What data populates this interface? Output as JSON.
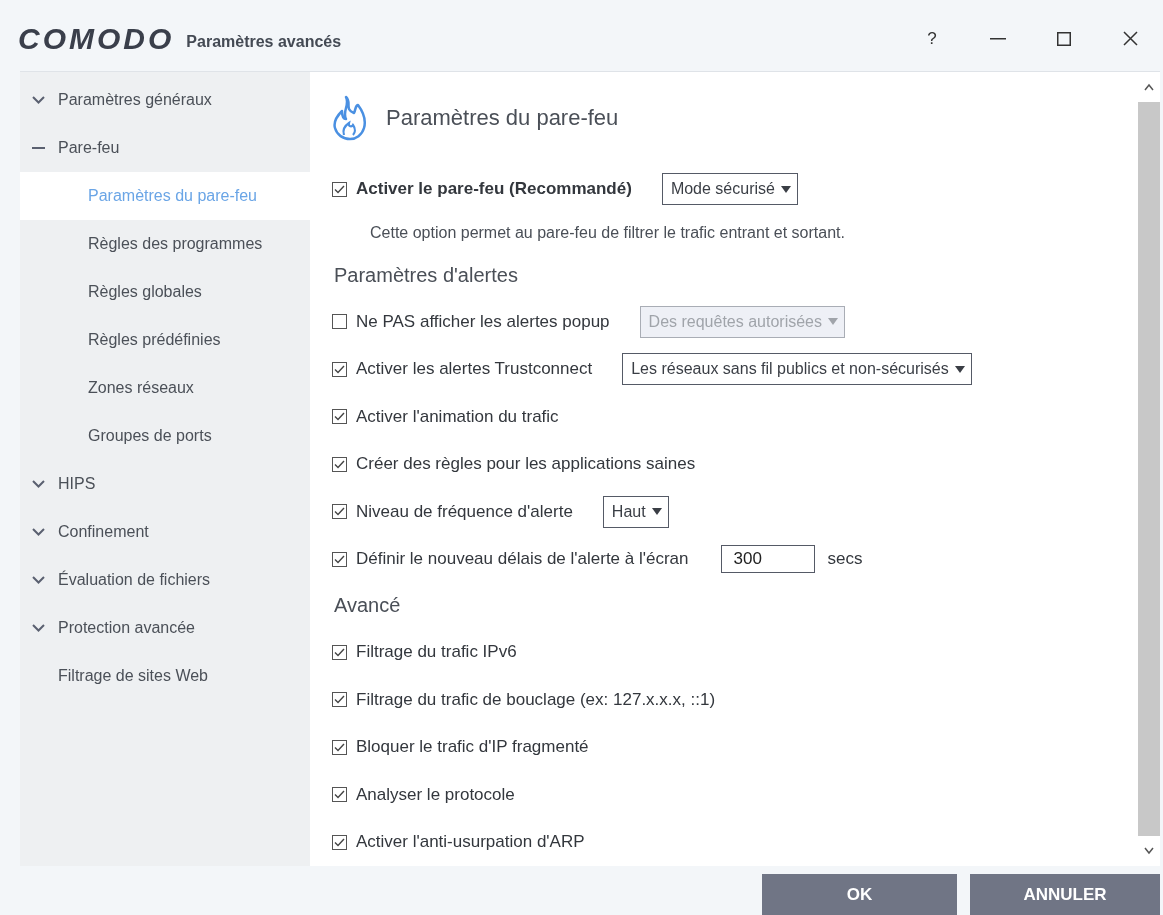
{
  "window": {
    "logo": "COMODO",
    "title": "Paramètres avancés",
    "controls": [
      {
        "kind": "help",
        "label": "?"
      },
      {
        "kind": "minimize"
      },
      {
        "kind": "maximize"
      },
      {
        "kind": "close"
      }
    ]
  },
  "sidebar": {
    "items": [
      {
        "kind": "group",
        "label": "Paramètres généraux",
        "expanded": false
      },
      {
        "kind": "group",
        "label": "Pare-feu",
        "expanded": true,
        "children": [
          {
            "label": "Paramètres du pare-feu",
            "selected": true
          },
          {
            "label": "Règles des programmes",
            "selected": false
          },
          {
            "label": "Règles globales",
            "selected": false
          },
          {
            "label": "Règles prédéfinies",
            "selected": false
          },
          {
            "label": "Zones réseaux",
            "selected": false
          },
          {
            "label": "Groupes de ports",
            "selected": false
          }
        ]
      },
      {
        "kind": "group",
        "label": "HIPS",
        "expanded": false
      },
      {
        "kind": "group",
        "label": "Confinement",
        "expanded": false
      },
      {
        "kind": "group",
        "label": "Évaluation de fichiers",
        "expanded": false
      },
      {
        "kind": "group",
        "label": "Protection avancée",
        "expanded": false
      },
      {
        "kind": "leaf",
        "label": "Filtrage de sites Web"
      }
    ]
  },
  "main": {
    "title": "Paramètres du pare-feu",
    "blocks": [
      {
        "kind": "option",
        "label": "Activer le pare-feu (Recommandé)",
        "bold": true,
        "checked": true,
        "control": {
          "kind": "dropdown",
          "value": "Mode sécurisé",
          "disabled": false
        }
      },
      {
        "kind": "note",
        "text": "Cette option permet au pare-feu de filtrer le trafic entrant et sortant."
      },
      {
        "kind": "heading",
        "text": "Paramètres d'alertes"
      },
      {
        "kind": "option",
        "label": "Ne PAS afficher les alertes popup",
        "bold": false,
        "checked": false,
        "control": {
          "kind": "dropdown",
          "value": "Des requêtes autorisées",
          "disabled": true
        }
      },
      {
        "kind": "option",
        "label": "Activer les alertes Trustconnect",
        "bold": false,
        "checked": true,
        "control": {
          "kind": "dropdown",
          "value": "Les réseaux sans fil publics et non-sécurisés",
          "disabled": false
        }
      },
      {
        "kind": "option",
        "label": "Activer l'animation du trafic",
        "bold": false,
        "checked": true
      },
      {
        "kind": "option",
        "label": "Créer des règles pour les applications saines",
        "bold": false,
        "checked": true
      },
      {
        "kind": "option",
        "label": "Niveau de fréquence d'alerte",
        "bold": false,
        "checked": true,
        "control": {
          "kind": "dropdown",
          "value": "Haut",
          "disabled": false
        }
      },
      {
        "kind": "option",
        "label": "Définir le nouveau délais de l'alerte à l'écran",
        "bold": false,
        "checked": true,
        "control": {
          "kind": "field",
          "value": "300",
          "unit": "secs"
        }
      },
      {
        "kind": "heading",
        "text": "Avancé"
      },
      {
        "kind": "option",
        "label": "Filtrage du trafic IPv6",
        "bold": false,
        "checked": true
      },
      {
        "kind": "option",
        "label": "Filtrage du trafic de bouclage (ex: 127.x.x.x, ::1)",
        "bold": false,
        "checked": true
      },
      {
        "kind": "option",
        "label": "Bloquer le trafic d'IP fragmenté",
        "bold": false,
        "checked": true
      },
      {
        "kind": "option",
        "label": "Analyser le protocole",
        "bold": false,
        "checked": true
      },
      {
        "kind": "option",
        "label": "Activer l'anti-usurpation d'ARP",
        "bold": false,
        "checked": true
      }
    ]
  },
  "buttons": [
    "OK",
    "ANNULER"
  ]
}
